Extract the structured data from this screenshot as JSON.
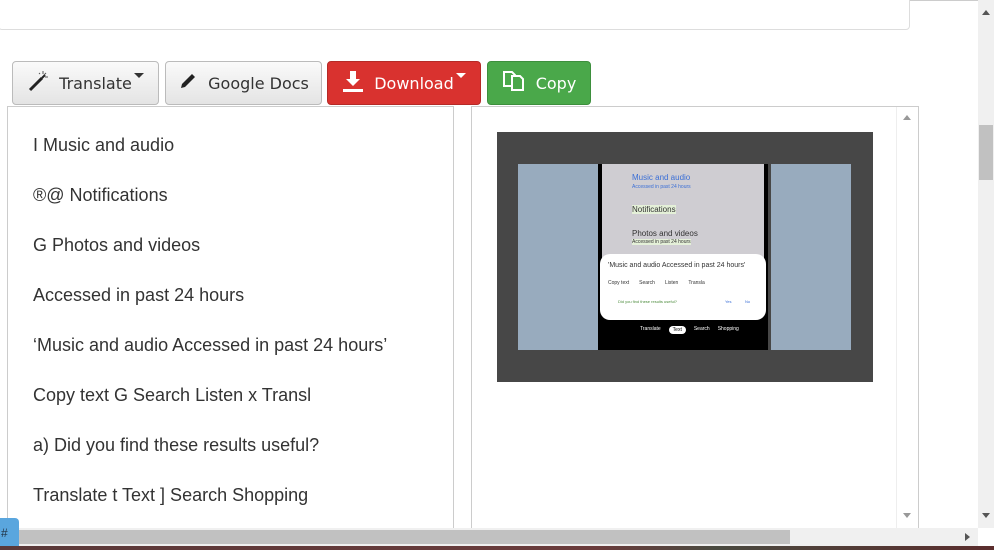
{
  "toolbar": {
    "translate_label": "Translate",
    "gdocs_label": "Google Docs",
    "download_label": "Download",
    "copy_label": "Copy"
  },
  "ocr_lines": [
    "I Music and audio",
    "®@ Notifications",
    "G Photos and videos",
    "Accessed in past 24 hours",
    "‘Music and audio Accessed in past 24 hours’",
    "Copy text G Search Listen x Transl",
    "a) Did you find these results useful?",
    "Translate t Text ] Search Shopping"
  ],
  "preview": {
    "items": [
      "Music and audio",
      "Accessed in past 24 hours",
      "Notifications",
      "Photos and videos",
      "Accessed in past 24 hours"
    ],
    "quote": "'Music and audio Accessed in past 24 hours'",
    "actions": [
      "Copy text",
      "Search",
      "Listen",
      "Transla"
    ],
    "feedback": "Did you find these results useful?",
    "yes": "Yes",
    "no": "No",
    "tabs": [
      "Translate",
      "Text",
      "Search",
      "Shopping"
    ]
  },
  "tag": "#",
  "colors": {
    "red": "#d9322f",
    "green": "#4aa84a",
    "blue": "#5aa6de"
  }
}
